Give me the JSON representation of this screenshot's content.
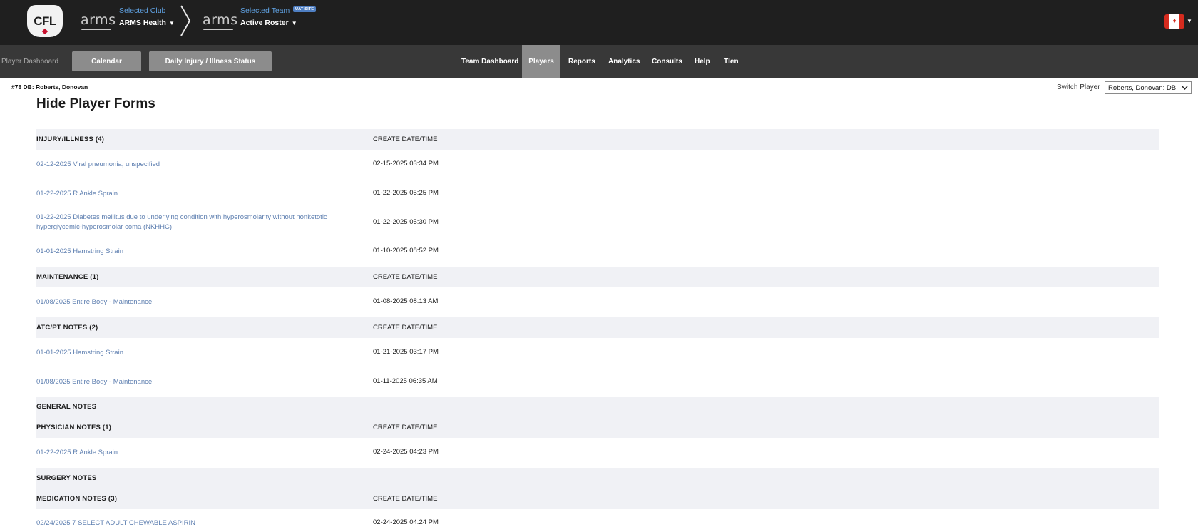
{
  "header": {
    "logo_text": "CFL",
    "brand_left": "arms",
    "brand_right": "arms",
    "selected_club_label": "Selected Club",
    "selected_club_value": "ARMS Health",
    "selected_team_label": "Selected Team",
    "selected_team_value": "Active Roster",
    "uat_badge": "UAT SITE"
  },
  "navbar": {
    "title": "Player Dashboard",
    "buttons": [
      "Calendar",
      "Daily Injury / Illness Status"
    ],
    "links": [
      "Team Dashboard",
      "Players",
      "Reports",
      "Analytics",
      "Consults",
      "Help",
      "Tlen"
    ],
    "active_link": "Players"
  },
  "player": {
    "id_label": "#78 DB: Roberts, Donovan",
    "switch_label": "Switch Player",
    "switch_value": "Roberts, Donovan: DB"
  },
  "page_title": "Hide Player Forms",
  "sections": [
    {
      "title": "INJURY/ILLNESS (4)",
      "col": "CREATE DATE/TIME",
      "rows": [
        {
          "link": "02-12-2025 Viral pneumonia, unspecified",
          "date": "02-15-2025 03:34 PM"
        },
        {
          "link": "01-22-2025 R Ankle Sprain",
          "date": "01-22-2025 05:25 PM"
        },
        {
          "link": "01-22-2025 Diabetes mellitus due to underlying condition with hyperosmolarity without nonketotic hyperglycemic-hyperosmolar coma (NKHHC)",
          "date": "01-22-2025 05:30 PM"
        },
        {
          "link": "01-01-2025 Hamstring Strain",
          "date": "01-10-2025 08:52 PM"
        }
      ]
    },
    {
      "title": "MAINTENANCE (1)",
      "col": "CREATE DATE/TIME",
      "rows": [
        {
          "link": "01/08/2025 Entire Body - Maintenance",
          "date": "01-08-2025 08:13 AM"
        }
      ]
    },
    {
      "title": "ATC/PT NOTES (2)",
      "col": "CREATE DATE/TIME",
      "rows": [
        {
          "link": "01-01-2025 Hamstring Strain",
          "date": "01-21-2025 03:17 PM"
        },
        {
          "link": "01/08/2025 Entire Body - Maintenance",
          "date": "01-11-2025 06:35 AM"
        }
      ]
    },
    {
      "title": "GENERAL NOTES",
      "col": "",
      "rows": []
    },
    {
      "title": "PHYSICIAN NOTES (1)",
      "col": "CREATE DATE/TIME",
      "rows": [
        {
          "link": "01-22-2025 R Ankle Sprain",
          "date": "02-24-2025 04:23 PM"
        }
      ]
    },
    {
      "title": "SURGERY NOTES",
      "col": "",
      "rows": []
    },
    {
      "title": "MEDICATION NOTES (3)",
      "col": "CREATE DATE/TIME",
      "rows": [
        {
          "link": "02/24/2025 7 SELECT ADULT CHEWABLE ASPIRIN",
          "date": "02-24-2025 04:24 PM"
        }
      ]
    }
  ],
  "icons": {
    "flag": "canada-flag-icon",
    "caret": "caret-down-icon",
    "chevron": "chevron-right-icon"
  }
}
